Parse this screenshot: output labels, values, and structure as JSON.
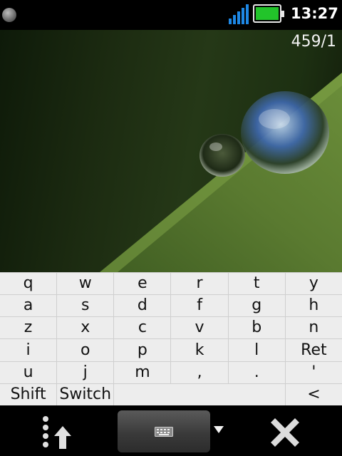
{
  "status_bar": {
    "time": "13:27",
    "icons": [
      "status-dot-icon",
      "signal-strength-icon",
      "battery-icon"
    ],
    "colors": {
      "battery_fill": "#22c42a",
      "signal": "#1e88e5"
    }
  },
  "viewer": {
    "counter": "459/1",
    "image_subject": "water droplets on a blade of grass"
  },
  "keyboard": {
    "rows": [
      [
        "q",
        "w",
        "e",
        "r",
        "t",
        "y"
      ],
      [
        "a",
        "s",
        "d",
        "f",
        "g",
        "h"
      ],
      [
        "z",
        "x",
        "c",
        "v",
        "b",
        "n"
      ],
      [
        "i",
        "o",
        "p",
        "k",
        "l",
        "Ret"
      ],
      [
        "u",
        "j",
        "m",
        ",",
        ".",
        "'"
      ]
    ],
    "bottom_row": {
      "shift": "Shift",
      "switch": "Switch",
      "space": "",
      "backspace": "<"
    }
  },
  "toolbar": {
    "icons": [
      "options-menu-icon",
      "keyboard-icon",
      "dropdown-arrow-icon",
      "close-icon"
    ]
  }
}
